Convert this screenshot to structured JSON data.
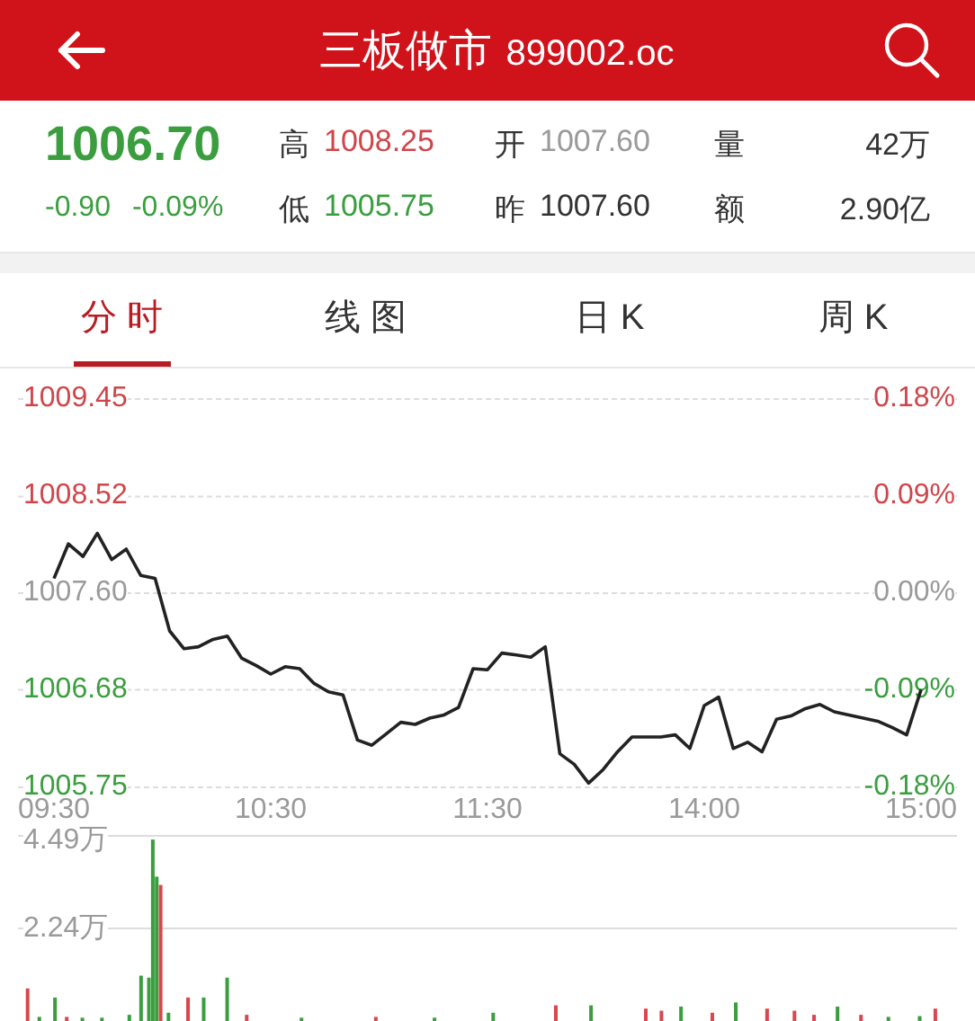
{
  "header": {
    "title": "三板做市",
    "code": "899002.oc"
  },
  "quote": {
    "price": "1006.70",
    "change": "-0.90",
    "change_pct": "-0.09%",
    "color": "#3a9e3f",
    "stats": [
      {
        "label": "高",
        "value": "1008.25",
        "color": "#d0454a"
      },
      {
        "label": "开",
        "value": "1007.60",
        "color": "#9a9a9a"
      },
      {
        "label": "量",
        "value": "42万",
        "color": "#333333"
      },
      {
        "label": "低",
        "value": "1005.75",
        "color": "#3a9e3f"
      },
      {
        "label": "昨",
        "value": "1007.60",
        "color": "#333333"
      },
      {
        "label": "额",
        "value": "2.90亿",
        "color": "#333333"
      }
    ]
  },
  "tabs": [
    {
      "label": "分 时",
      "selected": true
    },
    {
      "label": "线 图",
      "selected": false
    },
    {
      "label": "日 K",
      "selected": false
    },
    {
      "label": "周 K",
      "selected": false
    }
  ],
  "price_chart": {
    "chart_data": {
      "type": "line",
      "grid": true,
      "ylim": [
        1005.75,
        1009.45
      ],
      "categories": [
        "09:30",
        null,
        null,
        null,
        null,
        null,
        null,
        null,
        null,
        null,
        null,
        null,
        null,
        null,
        null,
        "10:30",
        null,
        null,
        null,
        null,
        null,
        null,
        null,
        null,
        null,
        null,
        null,
        null,
        null,
        null,
        "11:30",
        null,
        null,
        null,
        null,
        null,
        null,
        null,
        null,
        null,
        null,
        null,
        null,
        null,
        null,
        "14:00",
        null,
        null,
        null,
        null,
        null,
        null,
        null,
        null,
        null,
        null,
        null,
        null,
        null,
        null,
        "15:00"
      ],
      "yticks": [
        {
          "value": 1009.45,
          "label": "1009.45"
        },
        {
          "value": 1008.52,
          "label": "1008.52"
        },
        {
          "value": 1007.6,
          "label": "1007.60"
        },
        {
          "value": 1006.68,
          "label": "1006.68"
        },
        {
          "value": 1005.75,
          "label": "1005.75"
        }
      ],
      "series": [
        {
          "color": "#222222",
          "values": [
            1007.74,
            1008.07,
            1007.95,
            1008.17,
            1007.92,
            1008.02,
            1007.77,
            1007.74,
            1007.24,
            1007.07,
            1007.09,
            1007.16,
            1007.19,
            1006.98,
            1006.91,
            1006.83,
            1006.9,
            1006.88,
            1006.74,
            1006.66,
            1006.63,
            1006.2,
            1006.15,
            1006.26,
            1006.37,
            1006.35,
            1006.41,
            1006.44,
            1006.51,
            1006.88,
            1006.87,
            1007.03,
            1007.01,
            1006.99,
            1007.09,
            1006.07,
            1005.97,
            1005.79,
            1005.92,
            1006.09,
            1006.23,
            1006.23,
            1006.23,
            1006.25,
            1006.12,
            1006.53,
            1006.61,
            1006.12,
            1006.18,
            1006.09,
            1006.4,
            1006.43,
            1006.5,
            1006.54,
            1006.47,
            1006.44,
            1006.41,
            1006.38,
            1006.32,
            1006.25,
            1006.68
          ]
        }
      ]
    },
    "percent_labels": [
      {
        "label": "0.18%",
        "color": "#d0454a"
      },
      {
        "label": "0.09%",
        "color": "#d0454a"
      },
      {
        "label": "0.00%",
        "color": "#9a9a9a"
      },
      {
        "label": "-0.09%",
        "color": "#3a9e3f"
      },
      {
        "label": "-0.18%",
        "color": "#3a9e3f"
      }
    ]
  },
  "volume_chart": {
    "axis_labels": [
      "4.49万",
      "2.24万"
    ]
  }
}
